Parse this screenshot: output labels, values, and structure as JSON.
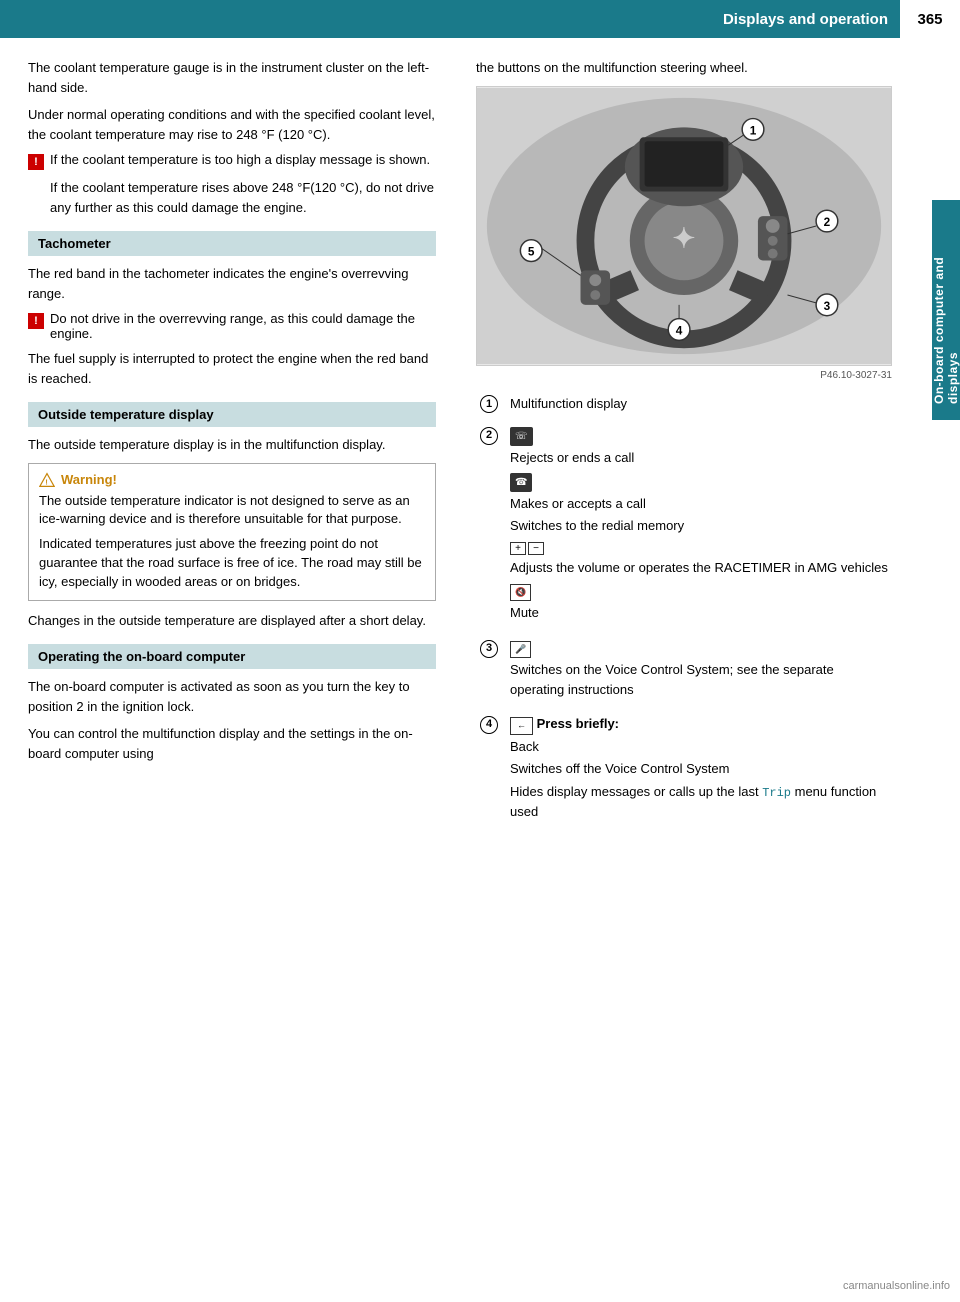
{
  "header": {
    "title": "Displays and operation",
    "page_number": "365"
  },
  "side_tab": "On-board computer and displays",
  "left_col": {
    "para1": "The coolant temperature gauge is in the instrument cluster on the left-hand side.",
    "para2": "Under normal operating conditions and with the specified coolant level, the coolant temperature may rise to 248 °F (120 °C).",
    "danger1": "If the coolant temperature is too high a display message is shown.",
    "danger1_indent": "If the coolant temperature rises above 248 °F(120 °C), do not drive any further as this could damage the engine.",
    "section_tachometer": "Tachometer",
    "tachometer_para": "The red band in the tachometer indicates the engine's overrevving range.",
    "danger2": "Do not drive in the overrevving range, as this could damage the engine.",
    "tachometer_para2": "The fuel supply is interrupted to protect the engine when the red band is reached.",
    "section_outside": "Outside temperature display",
    "outside_para": "The outside temperature display is in the multifunction display.",
    "warning_title": "Warning!",
    "warning_para1": "The outside temperature indicator is not designed to serve as an ice-warning device and is therefore unsuitable for that purpose.",
    "warning_para2": "Indicated temperatures just above the freezing point do not guarantee that the road surface is free of ice. The road may still be icy, especially in wooded areas or on bridges.",
    "changes_para": "Changes in the outside temperature are displayed after a short delay.",
    "section_onboard": "Operating the on-board computer",
    "onboard_para1": "The on-board computer is activated as soon as you turn the key to position 2 in the ignition lock.",
    "onboard_para2": "You can control the multifunction display and the settings in the on-board computer using"
  },
  "right_col": {
    "onboard_para2_cont": "the buttons on the multifunction steering wheel.",
    "image_label": "P46.10-3027-31",
    "items": [
      {
        "num": "1",
        "text": "Multifunction display"
      },
      {
        "num": "2",
        "icons": [
          "phone-end",
          "phone-accept",
          "vol",
          "mute"
        ],
        "lines": [
          "Rejects or ends a call",
          "Makes or accepts a call",
          "Switches to the redial memory",
          "Adjusts the volume or operates the RACETIMER in AMG vehicles",
          "Mute"
        ]
      },
      {
        "num": "3",
        "icons": [
          "voice"
        ],
        "lines": [
          "Switches on the Voice Control System; see the separate operating instructions"
        ]
      },
      {
        "num": "4",
        "icons": [
          "back"
        ],
        "bold_prefix": "Press briefly:",
        "lines": [
          "Back",
          "Switches off the Voice Control System",
          "Hides display messages or calls up the last Trip menu function used"
        ]
      }
    ]
  }
}
